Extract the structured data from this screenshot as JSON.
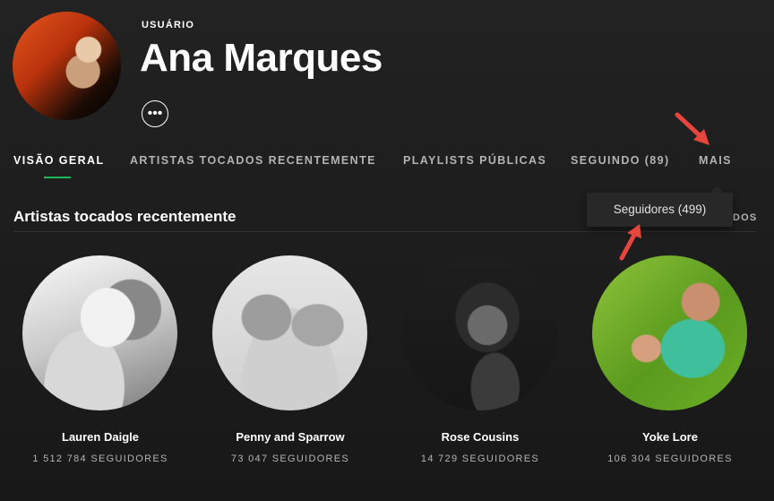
{
  "header": {
    "label": "USUÁRIO",
    "name": "Ana Marques",
    "more_glyph": "•••"
  },
  "tabs": [
    {
      "label": "VISÃO GERAL",
      "active": true
    },
    {
      "label": "ARTISTAS TOCADOS RECENTEMENTE",
      "active": false
    },
    {
      "label": "PLAYLISTS PÚBLICAS",
      "active": false
    },
    {
      "label": "SEGUINDO (89)",
      "active": false
    },
    {
      "label": "MAIS",
      "active": false
    }
  ],
  "dropdown": {
    "item": "Seguidores (499)"
  },
  "section": {
    "title": "Artistas tocados recentemente",
    "link_fragment": "DOS"
  },
  "artists": [
    {
      "name": "Lauren Daigle",
      "followers": "1 512 784 SEGUIDORES"
    },
    {
      "name": "Penny and Sparrow",
      "followers": "73 047 SEGUIDORES"
    },
    {
      "name": "Rose Cousins",
      "followers": "14 729 SEGUIDORES"
    },
    {
      "name": "Yoke Lore",
      "followers": "106 304 SEGUIDORES"
    }
  ],
  "colors": {
    "accent": "#1db954",
    "annotation_arrow": "#e8453c",
    "background": "#181818"
  },
  "icons": [
    "more-options-icon",
    "annotation-arrow-icon"
  ]
}
